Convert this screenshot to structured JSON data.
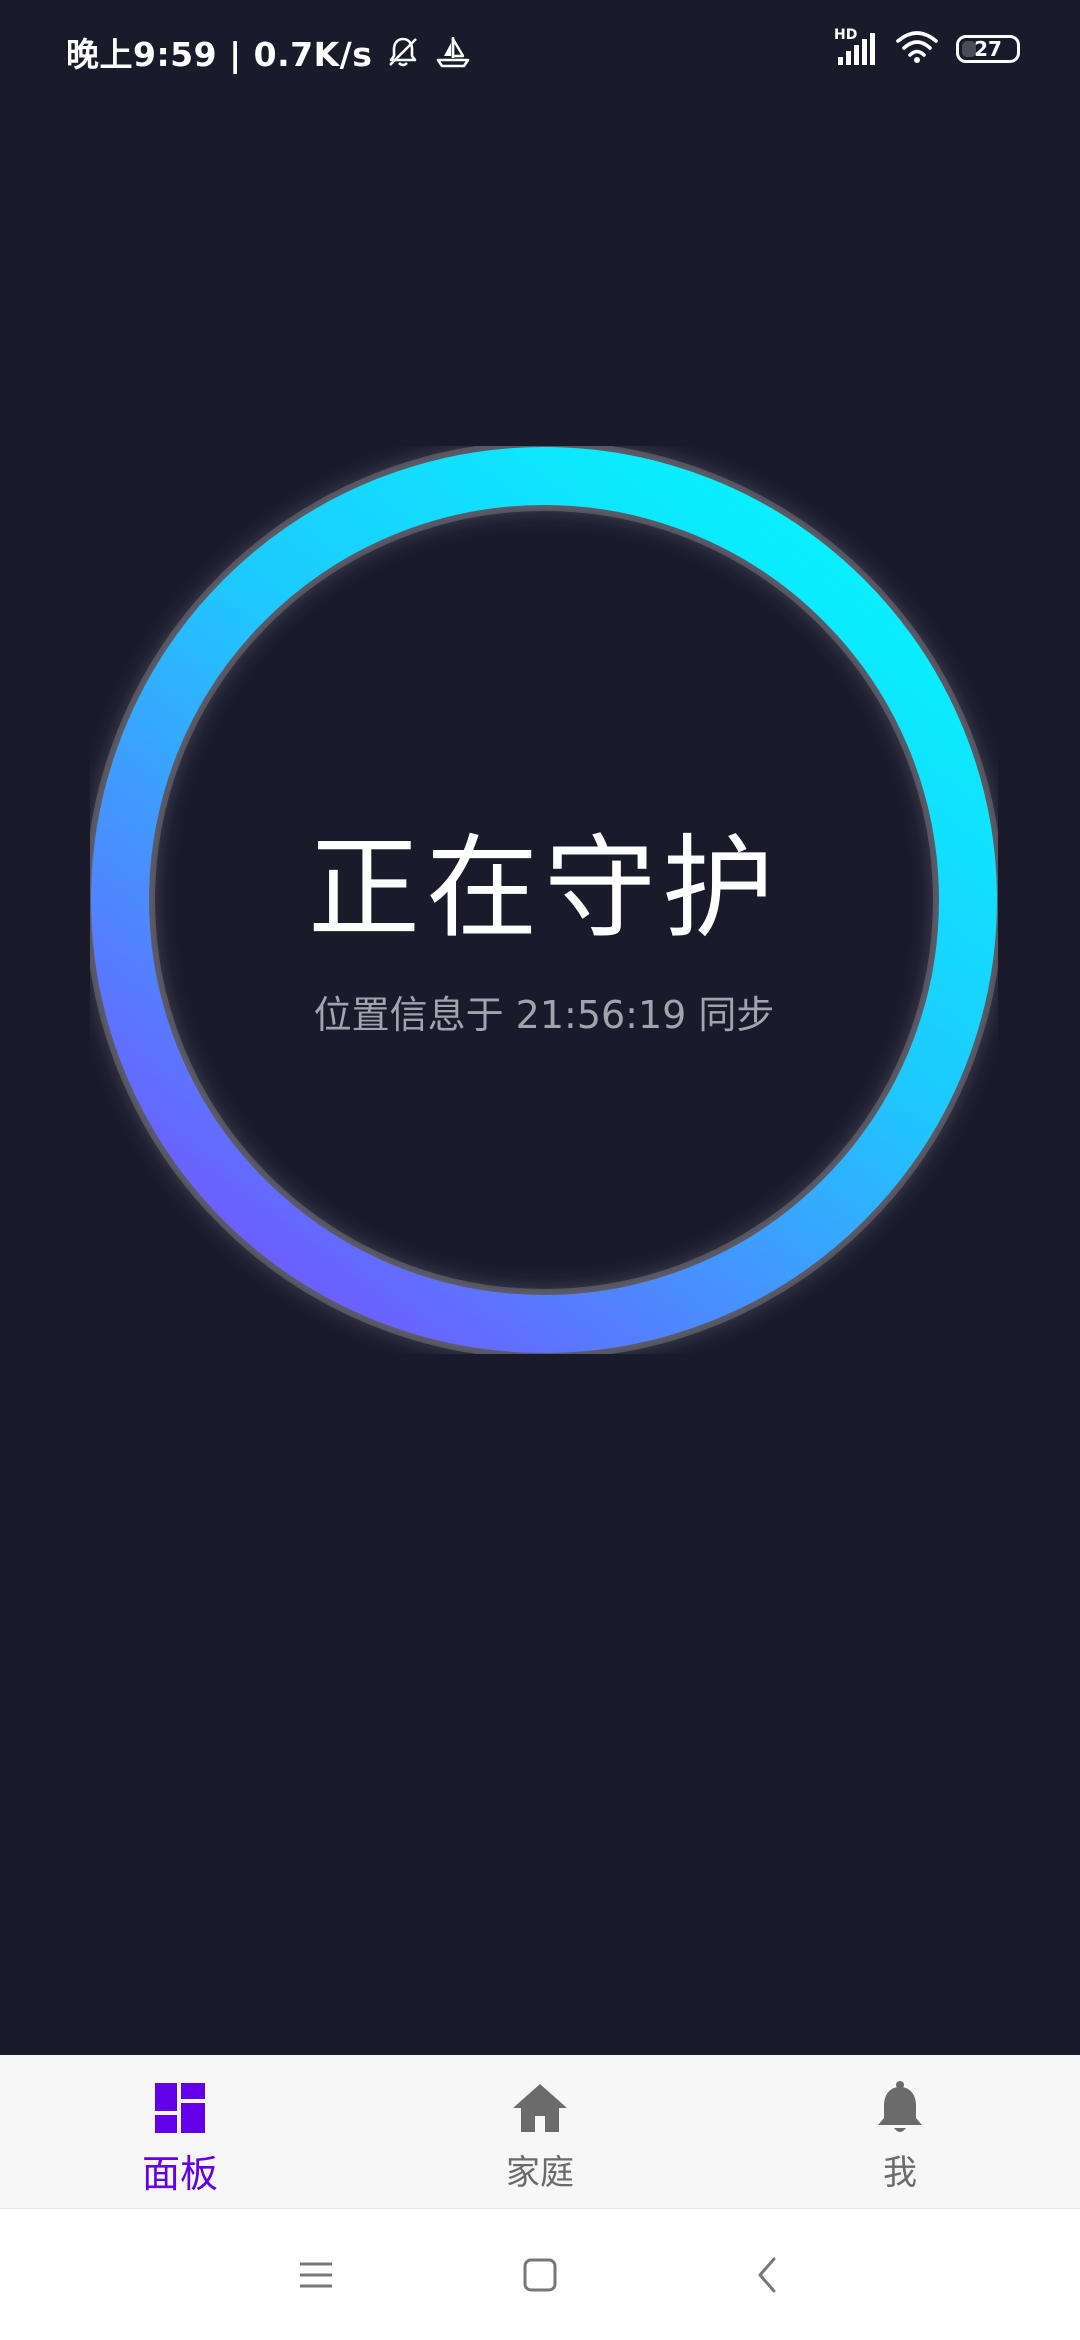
{
  "status_bar": {
    "time_text": "晚上9:59 | 0.7K/s",
    "signal_badge": "HD",
    "battery_level": "27",
    "battery_fraction": 0.27,
    "icons": [
      "bell-muted-icon",
      "sailboat-icon",
      "hd-signal-icon",
      "wifi-icon",
      "battery-icon"
    ]
  },
  "main": {
    "status_title": "正在守护",
    "sync_text": "位置信息于 21:56:19 同步"
  },
  "ring": {
    "gradient_start": "#00ffff",
    "gradient_mid": "#1ec8ff",
    "gradient_end": "#6e5cff",
    "glow_color": "#ffffff"
  },
  "bottom_nav": {
    "items": [
      {
        "label": "面板",
        "icon": "dashboard-icon",
        "active": true
      },
      {
        "label": "家庭",
        "icon": "home-icon",
        "active": false
      },
      {
        "label": "我",
        "icon": "bell-icon",
        "active": false
      }
    ],
    "active_color": "#6200ea",
    "inactive_color": "#6b6b6b"
  },
  "system_nav": {
    "buttons": [
      "menu-icon",
      "home-square-icon",
      "back-icon"
    ]
  },
  "colors": {
    "background": "#1a1a2b",
    "nav_background": "#f7f7f7"
  }
}
